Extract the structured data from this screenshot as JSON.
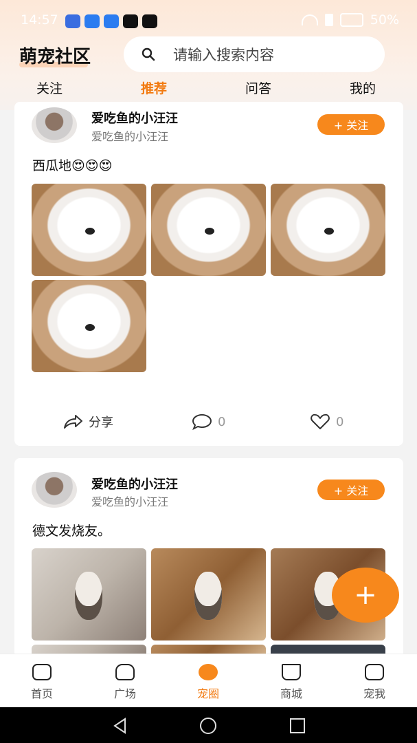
{
  "status": {
    "time": "14:57",
    "battery": "50%"
  },
  "header": {
    "title": "萌宠社区",
    "search_placeholder": "请输入搜索内容"
  },
  "tabs": [
    {
      "label": "关注"
    },
    {
      "label": "推荐"
    },
    {
      "label": "问答"
    },
    {
      "label": "我的"
    }
  ],
  "active_tab": "推荐",
  "posts": [
    {
      "username": "爱吃鱼的小汪汪",
      "subtitle": "爱吃鱼的小汪汪",
      "follow_label": "+ 关注",
      "text": "西瓜地😍😍😍",
      "share_label": "分享",
      "comment_count": "0",
      "like_count": "0"
    },
    {
      "username": "爱吃鱼的小汪汪",
      "subtitle": "爱吃鱼的小汪汪",
      "follow_label": "+ 关注",
      "text": "德文发烧友。"
    }
  ],
  "fab_label": "+",
  "bottom_nav": [
    {
      "label": "首页"
    },
    {
      "label": "广场"
    },
    {
      "label": "宠圈"
    },
    {
      "label": "商城"
    },
    {
      "label": "宠我"
    }
  ],
  "active_nav": "宠圈",
  "colors": {
    "accent": "#f7881c",
    "active_text": "#f27a10"
  }
}
